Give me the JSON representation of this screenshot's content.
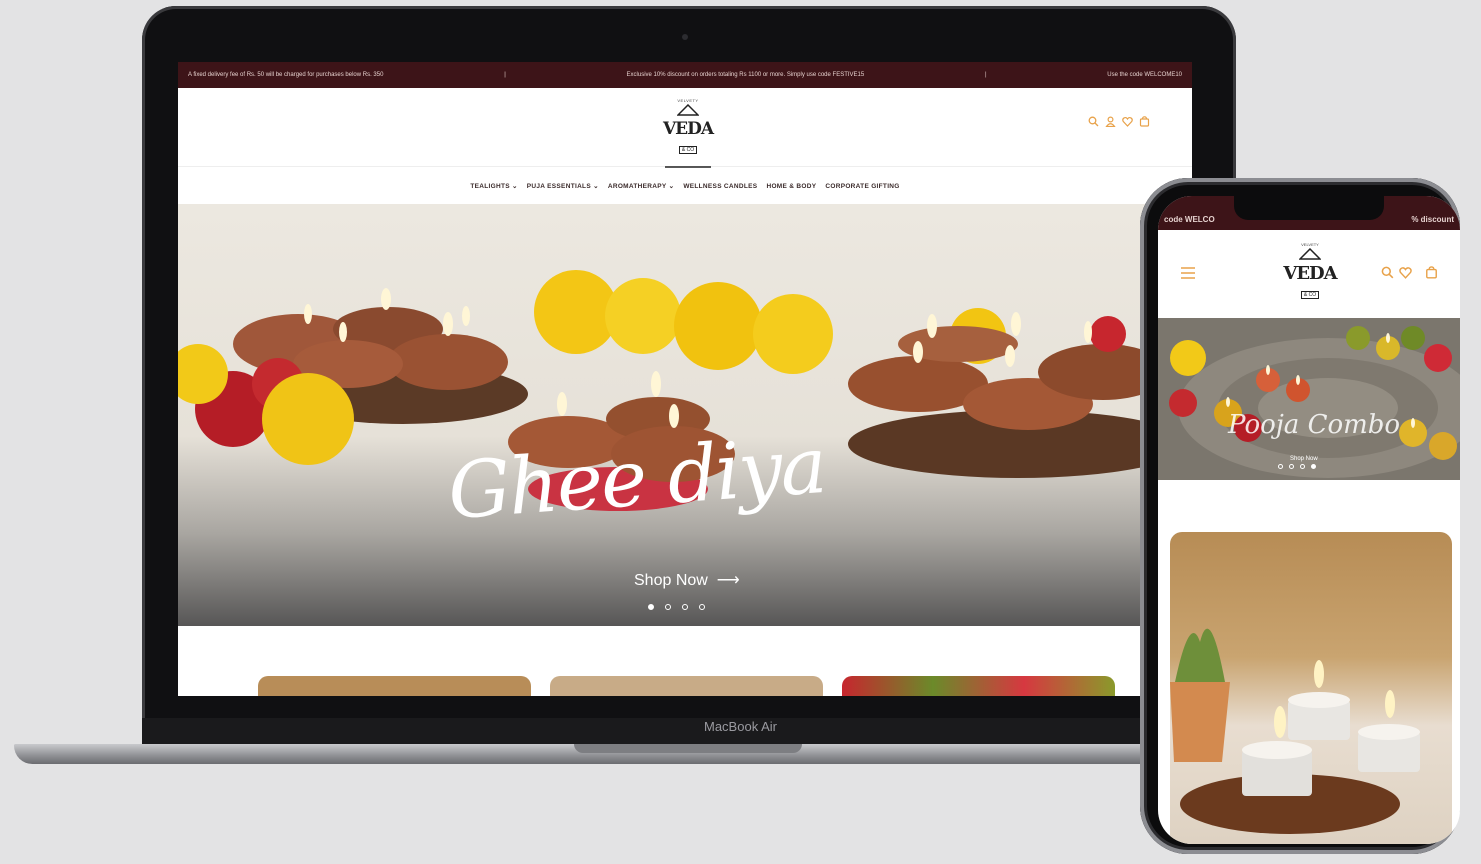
{
  "laptop": {
    "brand_label": "MacBook Air"
  },
  "site": {
    "announcements": [
      "A fixed delivery fee of Rs. 50 will be charged for purchases below Rs. 350",
      "Exclusive 10% discount on orders totaling Rs 1100 or more. Simply use code FESTIVE15",
      "Use the code WELCOME10"
    ],
    "logo": {
      "tagline": "VELVETY",
      "name": "VEDA",
      "sub": "& CO"
    },
    "nav": [
      {
        "label": "TEALIGHTS",
        "has_dropdown": true
      },
      {
        "label": "PUJA ESSENTIALS",
        "has_dropdown": true
      },
      {
        "label": "AROMATHERAPY",
        "has_dropdown": true
      },
      {
        "label": "WELLNESS CANDLES",
        "has_dropdown": false
      },
      {
        "label": "HOME & BODY",
        "has_dropdown": false
      },
      {
        "label": "CORPORATE GIFTING",
        "has_dropdown": false
      }
    ],
    "header_icons": [
      "search-icon",
      "account-icon",
      "wishlist-icon",
      "cart-icon"
    ],
    "hero": {
      "title": "Ghee diya",
      "cta": "Shop Now",
      "slides": 4,
      "active_slide": 1
    },
    "colors": {
      "announcement_bg": "#3d1418",
      "icon_accent": "#e8a24a"
    }
  },
  "phone": {
    "announcement_left": "code WELCO",
    "announcement_right": "% discount",
    "header_icons": [
      "menu-icon",
      "search-icon",
      "wishlist-icon",
      "cart-icon"
    ],
    "hero": {
      "title": "Pooja Combo",
      "cta": "Shop Now",
      "slides": 4,
      "active_slide": 4
    }
  }
}
